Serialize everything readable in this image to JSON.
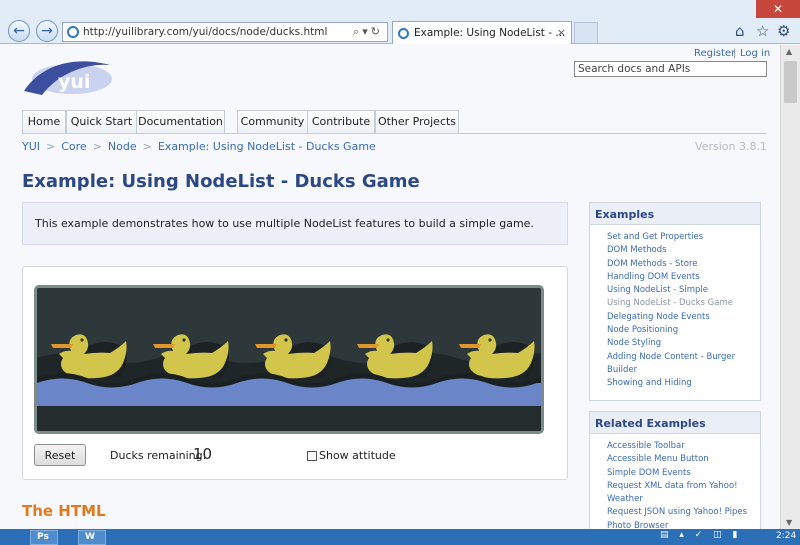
{
  "browser": {
    "url": "http://yuilibrary.com/yui/docs/node/ducks.html",
    "tab_title": "Example: Using NodeList - ...",
    "tab_close": "×",
    "back": "←",
    "forward": "→",
    "close_label": "✕"
  },
  "header": {
    "logo_text": "yui",
    "register": "Register",
    "separator": "|",
    "login": "Log in",
    "search_placeholder": "Search docs and APIs"
  },
  "nav": {
    "tabs": [
      "Home",
      "Quick Start",
      "Documentation",
      "Community",
      "Contribute",
      "Other Projects"
    ]
  },
  "breadcrumb": {
    "items": [
      "YUI",
      "Core",
      "Node",
      "Example: Using NodeList - Ducks Game"
    ],
    "separator": ">",
    "version": "Version 3.8.1"
  },
  "main": {
    "title": "Example: Using NodeList - Ducks Game",
    "intro": "This example demonstrates how to use multiple NodeList features to build a simple game.",
    "reset_label": "Reset",
    "ducks_label": "Ducks remaining:",
    "ducks_count": "10",
    "attitude_label": "Show attitude",
    "section_heading": "The HTML"
  },
  "sidebar": {
    "examples_title": "Examples",
    "examples": [
      "Set and Get Properties",
      "DOM Methods",
      "DOM Methods - Store",
      "Handling DOM Events",
      "Using NodeList - Simple",
      "Using NodeList - Ducks Game",
      "Delegating Node Events",
      "Node Positioning",
      "Node Styling",
      "Adding Node Content - Burger",
      "Builder",
      "Showing and Hiding"
    ],
    "current_index": 5,
    "related_title": "Related Examples",
    "related": [
      "Accessible Toolbar",
      "Accessible Menu Button",
      "Simple DOM Events",
      "Request XML data from Yahoo!",
      "Weather",
      "Request JSON using Yahoo! Pipes",
      "Photo Browser"
    ]
  },
  "taskbar": {
    "apps": [
      "Ps",
      "W"
    ],
    "clock": "2:24"
  },
  "colors": {
    "title": "#2c4785",
    "link": "#3a6bb5",
    "section_heading": "#e07a1f",
    "water": "#6a86c9",
    "duck": "#d2c54b"
  }
}
